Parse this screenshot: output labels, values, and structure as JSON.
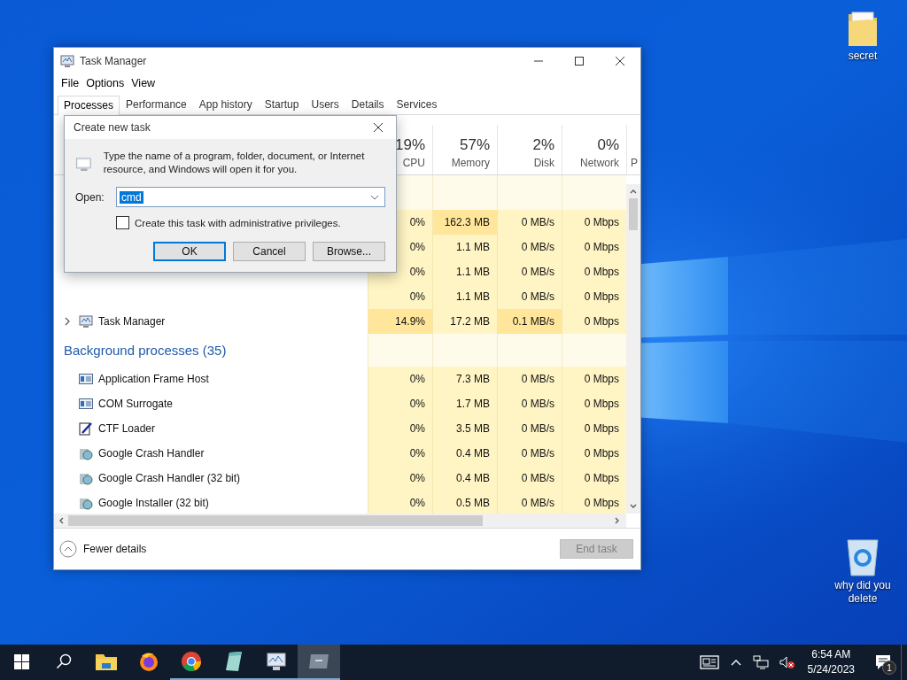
{
  "desktop_icons": [
    {
      "kind": "folder",
      "label": "secret"
    },
    {
      "kind": "recycle-bin",
      "label": "why did you delete"
    }
  ],
  "task_manager": {
    "title": "Task Manager",
    "menu": [
      "File",
      "Options",
      "View"
    ],
    "tabs": [
      {
        "label": "Processes",
        "selected": true
      },
      {
        "label": "Performance",
        "selected": false
      },
      {
        "label": "App history",
        "selected": false
      },
      {
        "label": "Startup",
        "selected": false
      },
      {
        "label": "Users",
        "selected": false
      },
      {
        "label": "Details",
        "selected": false
      },
      {
        "label": "Services",
        "selected": false
      }
    ],
    "columns": [
      {
        "percent": "19%",
        "label": "CPU"
      },
      {
        "percent": "57%",
        "label": "Memory"
      },
      {
        "percent": "2%",
        "label": "Disk"
      },
      {
        "percent": "0%",
        "label": "Network"
      },
      {
        "label": "P"
      }
    ],
    "groups": [
      {
        "rows": [
          {
            "cells": [
              {
                "text": "0%",
                "hot": false
              },
              {
                "text": "162.3 MB",
                "hot": true
              },
              {
                "text": "0 MB/s",
                "hot": false
              },
              {
                "text": "0 Mbps",
                "hot": false
              }
            ]
          },
          {
            "cells": [
              {
                "text": "0%",
                "hot": false
              },
              {
                "text": "1.1 MB",
                "hot": false
              },
              {
                "text": "0 MB/s",
                "hot": false
              },
              {
                "text": "0 Mbps",
                "hot": false
              }
            ]
          },
          {
            "cells": [
              {
                "text": "0%",
                "hot": false
              },
              {
                "text": "1.1 MB",
                "hot": false
              },
              {
                "text": "0 MB/s",
                "hot": false
              },
              {
                "text": "0 Mbps",
                "hot": false
              }
            ]
          },
          {
            "cells": [
              {
                "text": "0%",
                "hot": false
              },
              {
                "text": "1.1 MB",
                "hot": false
              },
              {
                "text": "0 MB/s",
                "hot": false
              },
              {
                "text": "0 Mbps",
                "hot": false
              }
            ]
          },
          {
            "kind": "monitor",
            "name": "Task Manager",
            "cells": [
              {
                "text": "14.9%",
                "hot": true
              },
              {
                "text": "17.2 MB",
                "hot": false
              },
              {
                "text": "0.1 MB/s",
                "hot": true
              },
              {
                "text": "0 Mbps",
                "hot": false
              }
            ]
          }
        ]
      },
      {
        "title": "Background processes (35)",
        "rows": [
          {
            "kind": "window",
            "name": "Application Frame Host",
            "cells": [
              {
                "text": "0%",
                "hot": false
              },
              {
                "text": "7.3 MB",
                "hot": false
              },
              {
                "text": "0 MB/s",
                "hot": false
              },
              {
                "text": "0 Mbps",
                "hot": false
              }
            ]
          },
          {
            "kind": "window",
            "name": "COM Surrogate",
            "cells": [
              {
                "text": "0%",
                "hot": false
              },
              {
                "text": "1.7 MB",
                "hot": false
              },
              {
                "text": "0 MB/s",
                "hot": false
              },
              {
                "text": "0 Mbps",
                "hot": false
              }
            ]
          },
          {
            "kind": "pen",
            "name": "CTF Loader",
            "cells": [
              {
                "text": "0%",
                "hot": false
              },
              {
                "text": "3.5 MB",
                "hot": false
              },
              {
                "text": "0 MB/s",
                "hot": false
              },
              {
                "text": "0 Mbps",
                "hot": false
              }
            ]
          },
          {
            "kind": "installer",
            "name": "Google Crash Handler",
            "cells": [
              {
                "text": "0%",
                "hot": false
              },
              {
                "text": "0.4 MB",
                "hot": false
              },
              {
                "text": "0 MB/s",
                "hot": false
              },
              {
                "text": "0 Mbps",
                "hot": false
              }
            ]
          },
          {
            "kind": "installer",
            "name": "Google Crash Handler (32 bit)",
            "cells": [
              {
                "text": "0%",
                "hot": false
              },
              {
                "text": "0.4 MB",
                "hot": false
              },
              {
                "text": "0 MB/s",
                "hot": false
              },
              {
                "text": "0 Mbps",
                "hot": false
              }
            ]
          },
          {
            "kind": "installer",
            "name": "Google Installer (32 bit)",
            "cells": [
              {
                "text": "0%",
                "hot": false
              },
              {
                "text": "0.5 MB",
                "hot": false
              },
              {
                "text": "0 MB/s",
                "hot": false
              },
              {
                "text": "0 Mbps",
                "hot": false
              }
            ]
          }
        ]
      }
    ],
    "footer": {
      "toggle": "Fewer details",
      "end_task": {
        "label": "End task",
        "disabled": true
      }
    }
  },
  "dialog": {
    "title": "Create new task",
    "message": "Type the name of a program, folder, document, or Internet resource, and Windows will open it for you.",
    "open_label": "Open:",
    "open_value": "cmd",
    "admin_checkbox": {
      "label": "Create this task with administrative privileges.",
      "checked": false
    },
    "buttons": [
      {
        "label": "OK",
        "default": true
      },
      {
        "label": "Cancel",
        "default": false
      },
      {
        "label": "Browse...",
        "default": false
      }
    ]
  },
  "taskbar": {
    "apps": [
      {
        "kind": "explorer",
        "running": false,
        "selected": false
      },
      {
        "kind": "firefox",
        "running": false,
        "selected": false
      },
      {
        "kind": "chrome",
        "running": true,
        "selected": false
      },
      {
        "kind": "notepad",
        "running": true,
        "selected": false
      },
      {
        "kind": "monitor",
        "running": true,
        "selected": false
      },
      {
        "kind": "run",
        "running": true,
        "selected": true
      }
    ],
    "time": "6:54 AM",
    "date": "5/24/2023",
    "notification_count": "1"
  }
}
